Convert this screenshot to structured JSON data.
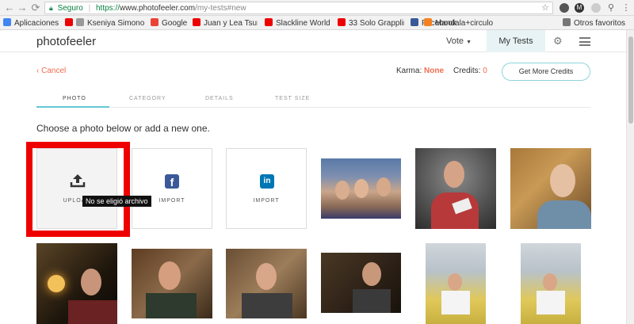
{
  "browser": {
    "secure_label": "Seguro",
    "url_proto": "https://",
    "url_host": "www.photofeeler.com",
    "url_path": "/my-tests#new",
    "bookmarks": [
      {
        "label": "Aplicaciones",
        "color": "#4285f4"
      },
      {
        "label": "Kseniya Simonov",
        "color": "#e00"
      },
      {
        "label": "Google",
        "color": "#ea4335"
      },
      {
        "label": "Juan y Lea Tsuna",
        "color": "#e00"
      },
      {
        "label": "Slackline Worldc",
        "color": "#e00"
      },
      {
        "label": "33 Solo Grappling",
        "color": "#e00"
      },
      {
        "label": "Facebook",
        "color": "#3b5998"
      },
      {
        "label": "Mandala+circulo",
        "color": "#f4811f"
      }
    ],
    "other_bookmarks": "Otros favoritos"
  },
  "header": {
    "logo": "photofeeler",
    "vote": "Vote",
    "my_tests": "My Tests"
  },
  "topbar": {
    "cancel": "Cancel",
    "karma_label": "Karma:",
    "karma_value": "None",
    "credits_label": "Credits:",
    "credits_value": "0",
    "get_more": "Get More Credits"
  },
  "tabs": [
    "PHOTO",
    "CATEGORY",
    "DETAILS",
    "TEST SIZE"
  ],
  "instruction": "Choose a photo below or add a new one.",
  "tiles": {
    "upload_label": "UPLOAD",
    "facebook_label": "IMPORT",
    "linkedin_label": "IMPORT",
    "tooltip": "No se eligió archivo"
  },
  "colors": {
    "accent": "#64c7d3",
    "orange": "#f26c4f",
    "facebook": "#3b5998",
    "linkedin": "#0077b5",
    "highlight": "#ee0000"
  }
}
